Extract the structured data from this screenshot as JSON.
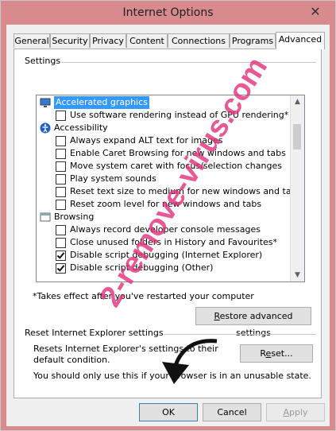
{
  "window": {
    "title": "Internet Options"
  },
  "tabs": [
    "General",
    "Security",
    "Privacy",
    "Content",
    "Connections",
    "Programs",
    "Advanced"
  ],
  "settings": {
    "label": "Settings",
    "items": [
      {
        "type": "category",
        "icon": "monitor-icon",
        "label": "Accelerated graphics",
        "selected": true
      },
      {
        "type": "checkbox",
        "label": "Use software rendering instead of GPU rendering*",
        "checked": false
      },
      {
        "type": "category",
        "icon": "accessibility-icon",
        "label": "Accessibility"
      },
      {
        "type": "checkbox",
        "label": "Always expand ALT text for images",
        "checked": false
      },
      {
        "type": "checkbox",
        "label": "Enable Caret Browsing for new windows and tabs",
        "checked": false
      },
      {
        "type": "checkbox",
        "label": "Move system caret with focus/selection changes",
        "checked": false
      },
      {
        "type": "checkbox",
        "label": "Play system sounds",
        "checked": false
      },
      {
        "type": "checkbox",
        "label": "Reset text size to medium for new windows and tabs",
        "checked": false
      },
      {
        "type": "checkbox",
        "label": "Reset zoom level for new windows and tabs",
        "checked": false
      },
      {
        "type": "category",
        "icon": "browsing-icon",
        "label": "Browsing"
      },
      {
        "type": "checkbox",
        "label": "Always record developer console messages",
        "checked": false
      },
      {
        "type": "checkbox",
        "label": "Close unused folders in History and Favourites*",
        "checked": false
      },
      {
        "type": "checkbox",
        "label": "Disable script debugging (Internet Explorer)",
        "checked": true
      },
      {
        "type": "checkbox",
        "label": "Disable script debugging (Other)",
        "checked": true
      }
    ],
    "note": "*Takes effect after you've restarted your computer",
    "restore_button": "Restore advanced settings"
  },
  "reset": {
    "label": "Reset Internet Explorer settings",
    "description": "Resets Internet Explorer's settings to their default condition.",
    "reset_button": "Reset...",
    "warning": "You should only use this if your browser is in an unusable state."
  },
  "footer": {
    "ok": "OK",
    "cancel": "Cancel",
    "apply": "Apply"
  },
  "watermark": {
    "text": "2-remove-virus.com",
    "color": "#e0307a"
  }
}
